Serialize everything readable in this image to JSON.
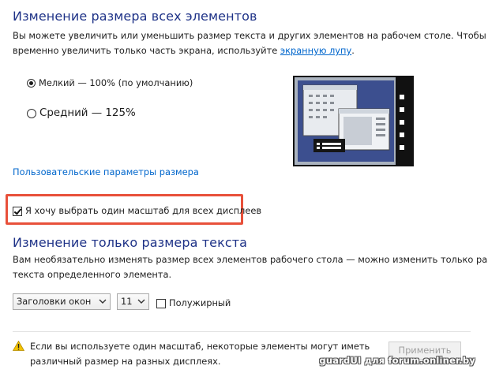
{
  "section1": {
    "title": "Изменение размера всех элементов",
    "desc_line1": "Вы можете увеличить или уменьшить размер текста и других элементов на рабочем столе. Чтобы",
    "desc_line2_pre": "временно увеличить только часть экрана, используйте ",
    "desc_link": "экранную лупу",
    "desc_line2_post": "."
  },
  "options": {
    "small_label": "Мелкий — 100% (по умолчанию)",
    "medium_label": "Средний — 125%",
    "selected": "small"
  },
  "custom_link": "Пользовательские параметры размера",
  "one_scale_checkbox": {
    "label": "Я хочу выбрать один масштаб для всех дисплеев",
    "checked": true
  },
  "section2": {
    "title": "Изменение только размера текста",
    "desc_line1": "Вам необязательно изменять размер всех элементов рабочего стола — можно изменить только размер",
    "desc_line2": "текста определенного элемента."
  },
  "text_controls": {
    "element_select": "Заголовки окон",
    "size_select": "11",
    "bold_label": "Полужирный",
    "bold_checked": false
  },
  "warning": {
    "icon": "warning-icon",
    "line1": "Если вы используете один масштаб, некоторые элементы могут иметь",
    "line2": "различный размер на разных дисплеях."
  },
  "apply_button": "Применить",
  "watermark": "guardUI для forum.onliner.by",
  "colors": {
    "heading": "#1e3287",
    "link": "#0066cc",
    "highlight": "#e8503a"
  }
}
